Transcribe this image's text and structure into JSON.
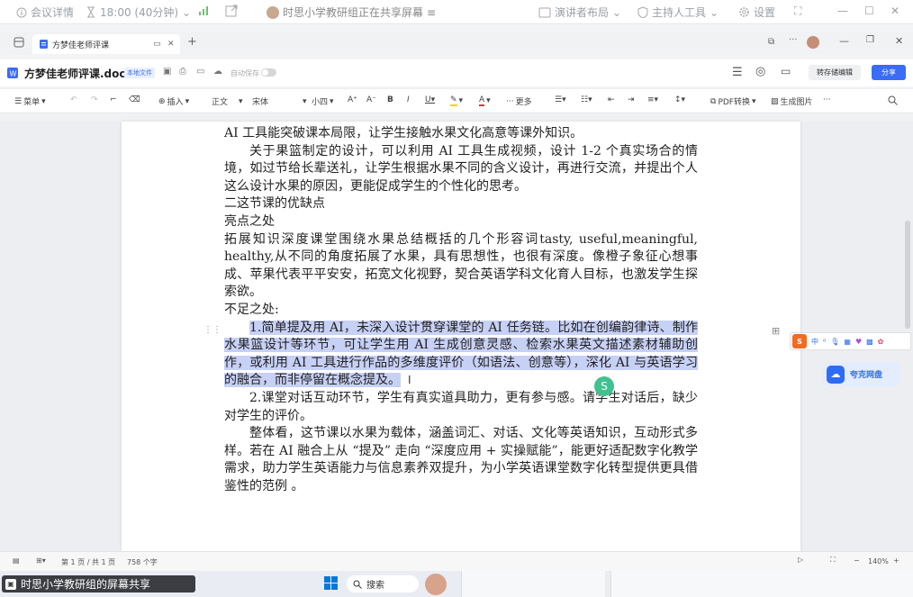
{
  "meeting_bar": {
    "details": "会议详情",
    "time": "18:00 (40分钟)",
    "sharing_text": "时思小学教研组正在共享屏幕",
    "presenter_layout": "演讲者布局",
    "host_tools": "主持人工具",
    "settings": "设置"
  },
  "tab": {
    "title": "方梦佳老师评课"
  },
  "header": {
    "filename": "方梦佳老师评课.docx",
    "badge": "本地文件",
    "autosave": "自动保存",
    "convert": "转存储编辑",
    "share": "分享"
  },
  "toolbar": {
    "menu": "菜单",
    "insert": "插入",
    "style": "正文",
    "font": "宋体",
    "size": "小四",
    "more": "更多",
    "pdf": "PDF转换",
    "image": "生成图片"
  },
  "document": {
    "cut_line": "AI 工具能突破课本局限，让学生接触水果文化高意等课外知识。",
    "p1": "关于果篮制定的设计，可以利用 AI 工具生成视频，设计 1-2 个真实场合的情境，如过节给长辈送礼，让学生根据水果不同的含义设计，再进行交流，并提出个人这么设计水果的原因，更能促成学生的个性化的思考。",
    "h2": "二这节课的优缺点",
    "sub1": "亮点之处",
    "p2": "拓展知识深度课堂围绕水果总结概括的几个形容词tasty, useful,meaningful, healthy,从不同的角度拓展了水果，具有思想性，也很有深度。像橙子象征心想事成、苹果代表平平安安，拓宽文化视野，契合英语学科文化育人目标，也激发学生探索欲。",
    "sub2": "不足之处:",
    "p3": "1.简单提及用 AI，未深入设计贯穿课堂的 AI 任务链。比如在创编韵律诗、制作水果篮设计等环节，可让学生用 AI 生成创意灵感、检索水果英文描述素材辅助创作，或利用 AI 工具进行作品的多维度评价（如语法、创意等），深化 AI 与英语学习的融合，而非停留在概念提及。",
    "p4": "2.课堂对话互动环节，学生有真实道具助力，更有参与感。请学生对话后，缺少对学生的评价。",
    "p5": "整体看，这节课以水果为载体，涵盖词汇、对话、文化等英语知识，互动形式多样。若在 AI 融合上从 “提及” 走向 “深度应用 + 实操赋能”，能更好适配数字化教学需求，助力学生英语能力与信息素养双提升，为小学英语课堂数字化转型提供更具借鉴性的范例 。"
  },
  "side": {
    "cloud": "夸克网盘"
  },
  "status": {
    "page": "第 1 页 / 共 1 页",
    "words": "758 个字",
    "zoom": "140%"
  },
  "taskbar": {
    "share": "时思小学教研组的屏幕共享",
    "search": "搜索"
  },
  "colors": {
    "accent": "#3b6cf6",
    "highlight": "#c7d0f5",
    "cloud": "#2f6cf5"
  }
}
